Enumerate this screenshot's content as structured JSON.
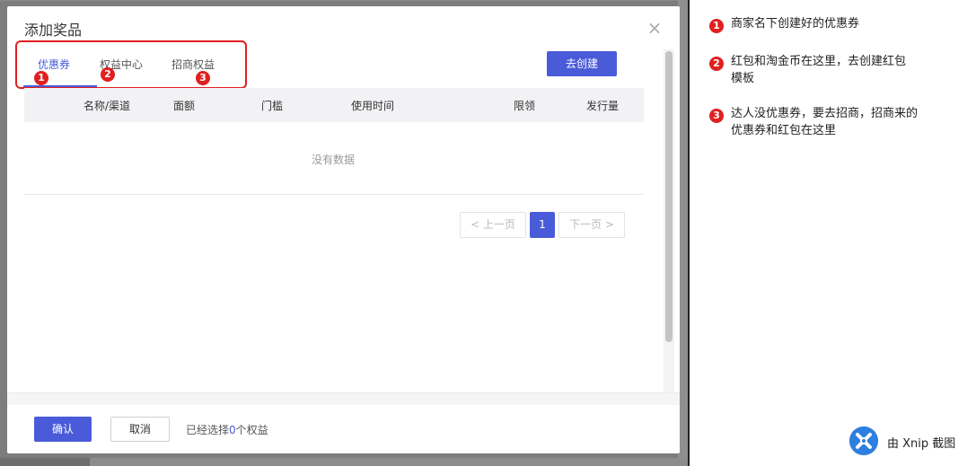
{
  "modal": {
    "title": "添加奖品",
    "close": "×"
  },
  "tabs": [
    {
      "label": "优惠券",
      "badge": "1"
    },
    {
      "label": "权益中心",
      "badge": "2"
    },
    {
      "label": "招商权益",
      "badge": "3"
    }
  ],
  "toolbar": {
    "create_label": "去创建"
  },
  "table": {
    "columns": [
      "名称/渠道",
      "面额",
      "门槛",
      "使用时间",
      "限领",
      "发行量"
    ],
    "empty_text": "没有数据"
  },
  "pagination": {
    "prev": "< 上一页",
    "current": "1",
    "next": "下一页 >"
  },
  "footer": {
    "confirm_label": "确认",
    "cancel_label": "取消",
    "selected_prefix": "已经选择",
    "selected_count": "0",
    "selected_suffix": "个权益"
  },
  "annotations": [
    {
      "badge": "1",
      "line1": "商家名下创建好的优惠券",
      "line2": ""
    },
    {
      "badge": "2",
      "line1": "红包和淘金币在这里，去创建红包",
      "line2": "模板"
    },
    {
      "badge": "3",
      "line1": "达人没优惠券，要去招商，招商来的",
      "line2": "优惠券和红包在这里"
    }
  ],
  "watermark": {
    "text": "由 Xnip 截图"
  },
  "colors": {
    "accent": "#4a5bd9",
    "annotation_red": "#e02020"
  }
}
